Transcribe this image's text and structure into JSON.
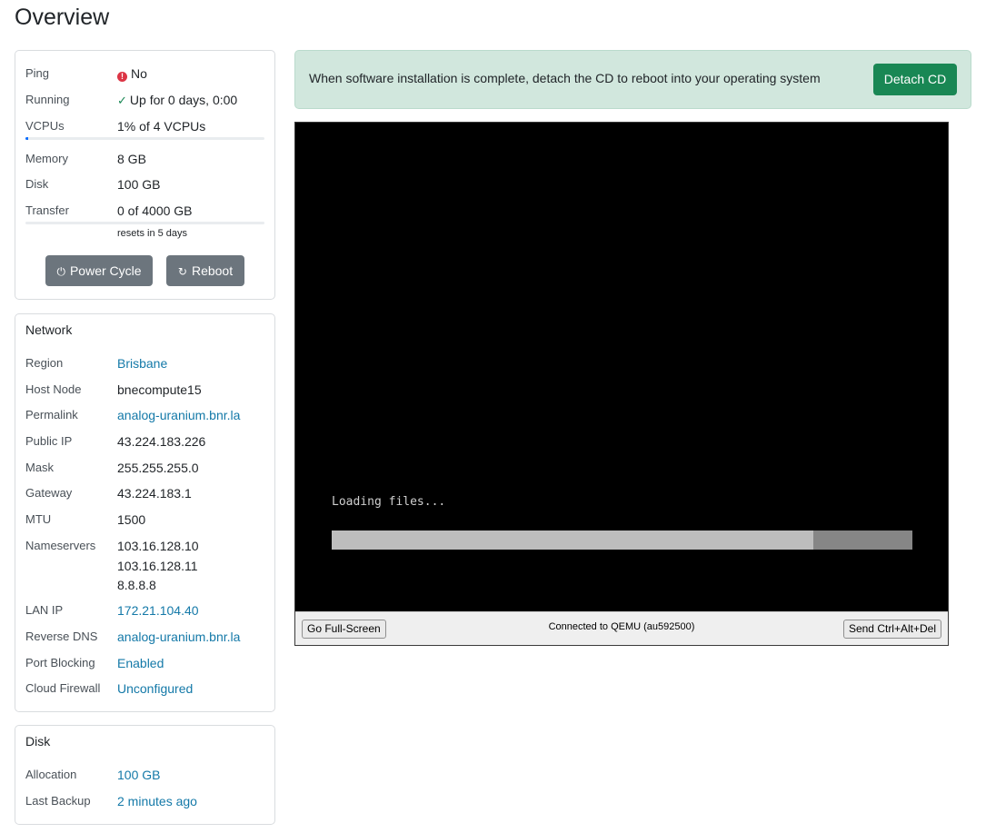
{
  "page": {
    "title": "Overview"
  },
  "status": {
    "ping_label": "Ping",
    "ping_value": "No",
    "running_label": "Running",
    "running_value": "Up for 0 days, 0:00",
    "vcpus_label": "VCPUs",
    "vcpus_value": "1% of 4 VCPUs",
    "vcpus_percent": 1,
    "memory_label": "Memory",
    "memory_value": "8 GB",
    "disk_label": "Disk",
    "disk_value": "100 GB",
    "transfer_label": "Transfer",
    "transfer_value": "0 of 4000 GB",
    "transfer_percent": 0,
    "transfer_note": "resets in 5 days",
    "power_cycle_label": "Power Cycle",
    "reboot_label": "Reboot"
  },
  "network": {
    "title": "Network",
    "region_label": "Region",
    "region_value": "Brisbane",
    "host_node_label": "Host Node",
    "host_node_value": "bnecompute15",
    "permalink_label": "Permalink",
    "permalink_value": "analog-uranium.bnr.la",
    "public_ip_label": "Public IP",
    "public_ip_value": "43.224.183.226",
    "mask_label": "Mask",
    "mask_value": "255.255.255.0",
    "gateway_label": "Gateway",
    "gateway_value": "43.224.183.1",
    "mtu_label": "MTU",
    "mtu_value": "1500",
    "nameservers_label": "Nameservers",
    "nameservers": [
      "103.16.128.10",
      "103.16.128.11",
      "8.8.8.8"
    ],
    "lan_ip_label": "LAN IP",
    "lan_ip_value": "172.21.104.40",
    "reverse_dns_label": "Reverse DNS",
    "reverse_dns_value": "analog-uranium.bnr.la",
    "port_blocking_label": "Port Blocking",
    "port_blocking_value": "Enabled",
    "cloud_firewall_label": "Cloud Firewall",
    "cloud_firewall_value": "Unconfigured"
  },
  "disk_card": {
    "title": "Disk",
    "allocation_label": "Allocation",
    "allocation_value": "100 GB",
    "last_backup_label": "Last Backup",
    "last_backup_value": "2 minutes ago"
  },
  "alert": {
    "message": "When software installation is complete, detach the CD to reboot into your operating system",
    "button_label": "Detach CD"
  },
  "console": {
    "screen_text": "Loading files...",
    "loading_fraction": 0.83,
    "fullscreen_label": "Go Full-Screen",
    "status_text": "Connected to QEMU (au592500)",
    "ctrl_alt_del_label": "Send Ctrl+Alt+Del"
  },
  "colors": {
    "link": "#1479a8",
    "success": "#198754",
    "alert_bg": "#d1e7dd",
    "secondary": "#6c757d",
    "danger": "#dc3545"
  }
}
